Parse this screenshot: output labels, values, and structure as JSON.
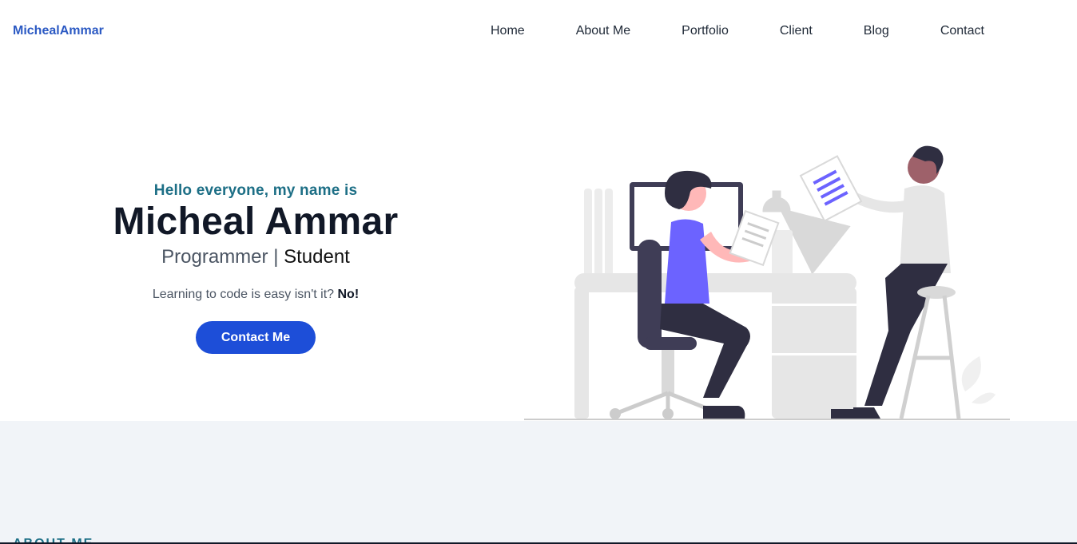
{
  "nav": {
    "brand": "MichealAmmar",
    "links": [
      "Home",
      "About Me",
      "Portfolio",
      "Client",
      "Blog",
      "Contact"
    ]
  },
  "hero": {
    "greeting": "Hello everyone, my name is",
    "name": "Micheal Ammar",
    "role_primary": "Programmer",
    "role_separator": "|",
    "role_secondary": "Student",
    "tagline": "Learning to code is easy isn't it?",
    "tagline_emphasis": "No!",
    "cta_label": "Contact Me"
  },
  "next_section": {
    "heading_peek": "ABOUT ME"
  },
  "colors": {
    "brand": "#2b59c3",
    "greeting": "#1d6f86",
    "cta": "#1d4ed8",
    "accent_purple": "#6c63ff",
    "section_bg": "#f1f4f8"
  },
  "icons": {
    "illustration": "people-working-illustration"
  }
}
